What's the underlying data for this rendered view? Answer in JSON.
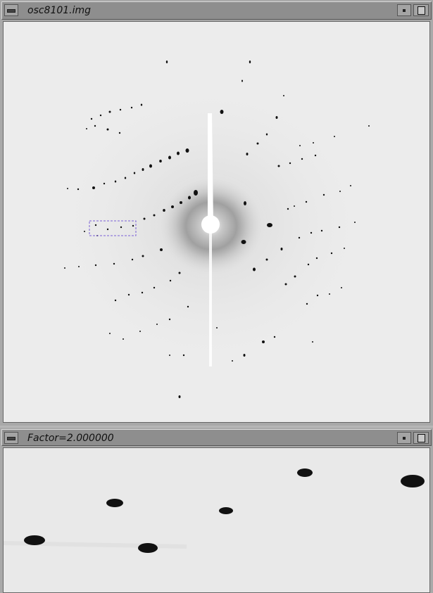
{
  "main_window": {
    "title": "osc8101.img"
  },
  "zoom_window": {
    "title": "Factor=2.000000"
  },
  "colors": {
    "background": "#ececec",
    "spot": "#111111",
    "selection_box": "#7a5fd6",
    "title_bar": "#8e8e8e"
  },
  "icons": [
    "window-menu-icon",
    "iconify-icon",
    "maximize-icon"
  ]
}
